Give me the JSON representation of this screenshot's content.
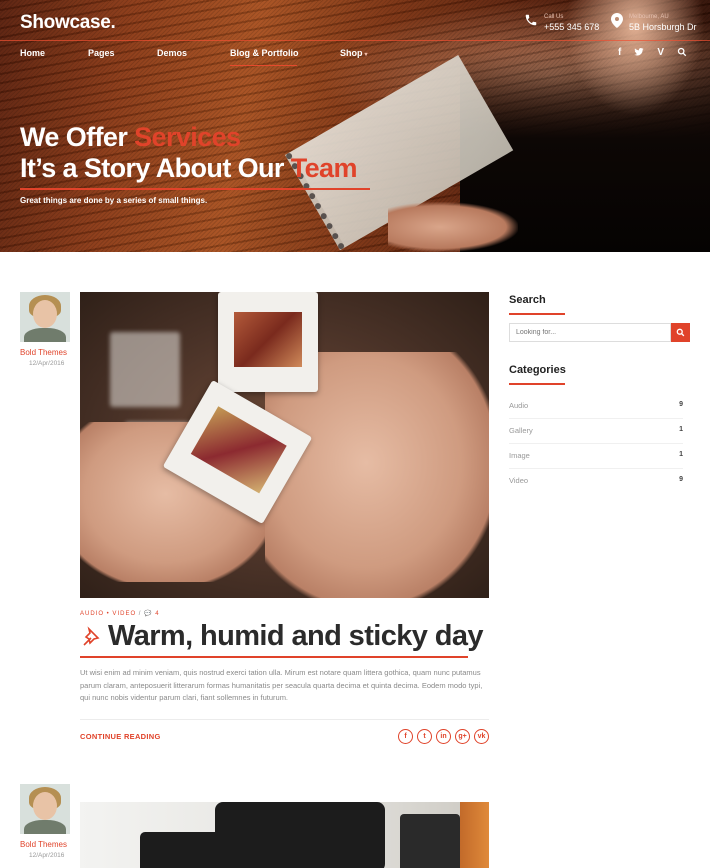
{
  "header": {
    "logo": "Showcase.",
    "contacts": [
      {
        "icon": "phone-icon",
        "label": "Call Us",
        "value": "+555 345 678"
      },
      {
        "icon": "location-pin-icon",
        "label": "Melbourne, AU",
        "value": "5B Horsburgh Dr"
      }
    ],
    "nav": [
      {
        "label": "Home"
      },
      {
        "label": "Pages"
      },
      {
        "label": "Demos"
      },
      {
        "label": "Blog & Portfolio",
        "active": true
      },
      {
        "label": "Shop",
        "dropdown": true
      }
    ],
    "social": [
      {
        "icon": "facebook-icon",
        "glyph": "f"
      },
      {
        "icon": "twitter-icon",
        "glyph": "🐦"
      },
      {
        "icon": "vimeo-icon",
        "glyph": "V"
      },
      {
        "icon": "search-icon",
        "glyph": "⚲"
      }
    ]
  },
  "hero": {
    "line1_white": "We Offer ",
    "line1_red": "Services",
    "line2_white": "It’s a Story About Our ",
    "line2_red": "Team",
    "subtitle": "Great things are done by a series of small things."
  },
  "posts": [
    {
      "author": "Bold Themes",
      "date": "12/Apr/2016",
      "categories": "AUDIO • VIDEO",
      "comments": "4",
      "title": "Warm, humid and sticky day",
      "excerpt": "Ut wisi enim ad minim veniam, quis nostrud exerci tation ulla. Mirum est notare quam littera gothica, quam nunc putamus parum claram, anteposuerit litterarum formas humanitatis per seacula quarta decima et quinta decima. Eodem modo typi, qui nunc nobis videntur parum clari, fiant sollemnes in futurum.",
      "continue_label": "CONTINUE READING",
      "share": [
        {
          "icon": "facebook-share-icon",
          "glyph": "f"
        },
        {
          "icon": "twitter-share-icon",
          "glyph": "t"
        },
        {
          "icon": "linkedin-share-icon",
          "glyph": "in"
        },
        {
          "icon": "google-plus-share-icon",
          "glyph": "g+"
        },
        {
          "icon": "vk-share-icon",
          "glyph": "vk"
        }
      ]
    },
    {
      "author": "Bold Themes",
      "date": "12/Apr/2016"
    }
  ],
  "sidebar": {
    "search_title": "Search",
    "search_placeholder": "Looking for...",
    "categories_title": "Categories",
    "categories": [
      {
        "name": "Audio",
        "count": "9"
      },
      {
        "name": "Gallery",
        "count": "1"
      },
      {
        "name": "Image",
        "count": "1"
      },
      {
        "name": "Video",
        "count": "9"
      }
    ]
  },
  "colors": {
    "accent": "#e0432a"
  }
}
